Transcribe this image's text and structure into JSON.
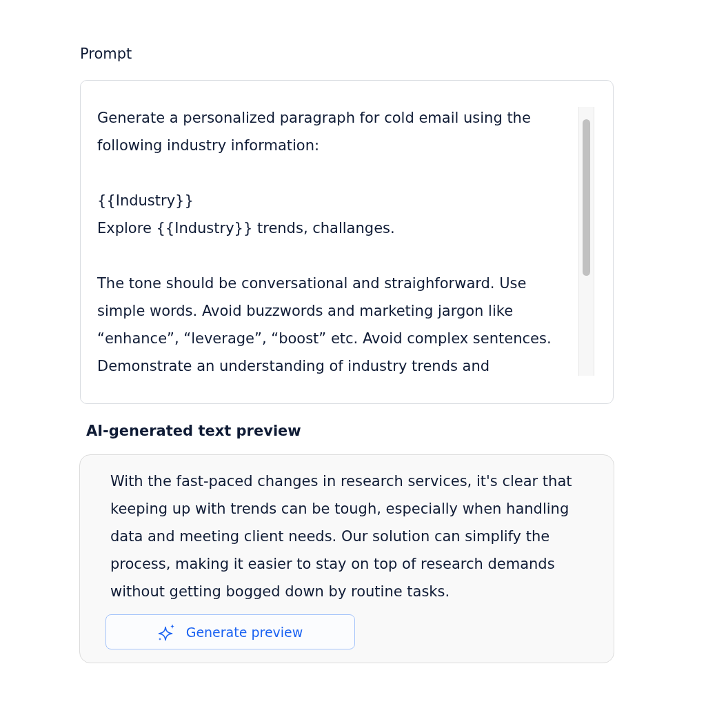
{
  "prompt": {
    "label": "Prompt",
    "paragraphs": [
      [
        "Generate a personalized paragraph for cold email using the",
        "following industry information:"
      ],
      [
        "{{Industry}}",
        "Explore {{Industry}} trends, challanges."
      ],
      [
        "The tone should be conversational and straighforward. Use",
        "simple words. Avoid buzzwords and marketing jargon like",
        "“enhance”, “leverage”, “boost” etc. Avoid complex sentences.",
        "Demonstrate an understanding of industry trends and"
      ]
    ]
  },
  "preview": {
    "label": "AI-generated text preview",
    "lines": [
      "With the fast-paced changes in research services, it's clear that",
      "keeping up with trends can be tough, especially when handling",
      "data and meeting client needs. Our solution can simplify the",
      "process, making it easier to stay on top of research demands",
      "without getting bogged down by routine tasks."
    ],
    "button": {
      "label": "Generate preview"
    }
  }
}
